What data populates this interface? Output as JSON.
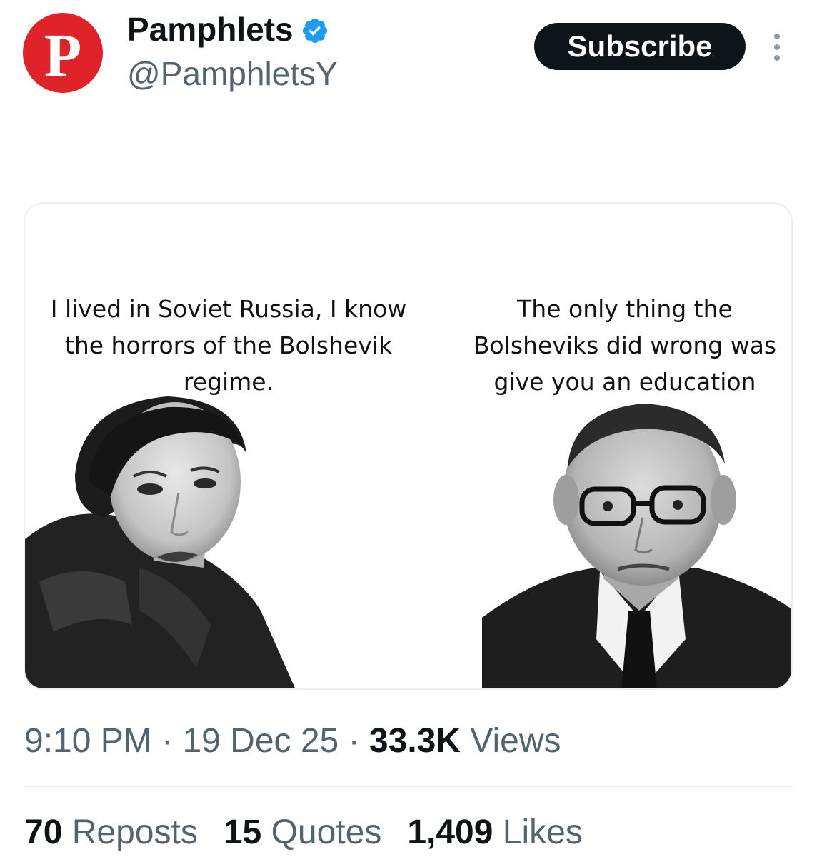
{
  "author": {
    "display_name": "Pamphlets",
    "handle": "@PamphletsY",
    "avatar_letter": "P",
    "avatar_color": "#e02229",
    "verified_icon": "verified-badge-icon",
    "verified_color": "#1d9bf0"
  },
  "header": {
    "subscribe_label": "Subscribe",
    "more_icon": "more-options-icon"
  },
  "media": {
    "quote_left": "I lived in Soviet Russia, I know the horrors of the Bolshevik regime.",
    "quote_right": "The only thing the Bolsheviks did wrong was give you an education"
  },
  "meta": {
    "time": "9:10 PM",
    "separator": "·",
    "date": "19 Dec 25",
    "views_count": "33.3K",
    "views_label": "Views"
  },
  "stats": [
    {
      "count": "70",
      "label": "Reposts"
    },
    {
      "count": "15",
      "label": "Quotes"
    },
    {
      "count": "1,409",
      "label": "Likes"
    }
  ],
  "colors": {
    "text_primary": "#0f1419",
    "text_secondary": "#536471",
    "button_bg": "#0f1419",
    "divider": "#eceff1"
  }
}
